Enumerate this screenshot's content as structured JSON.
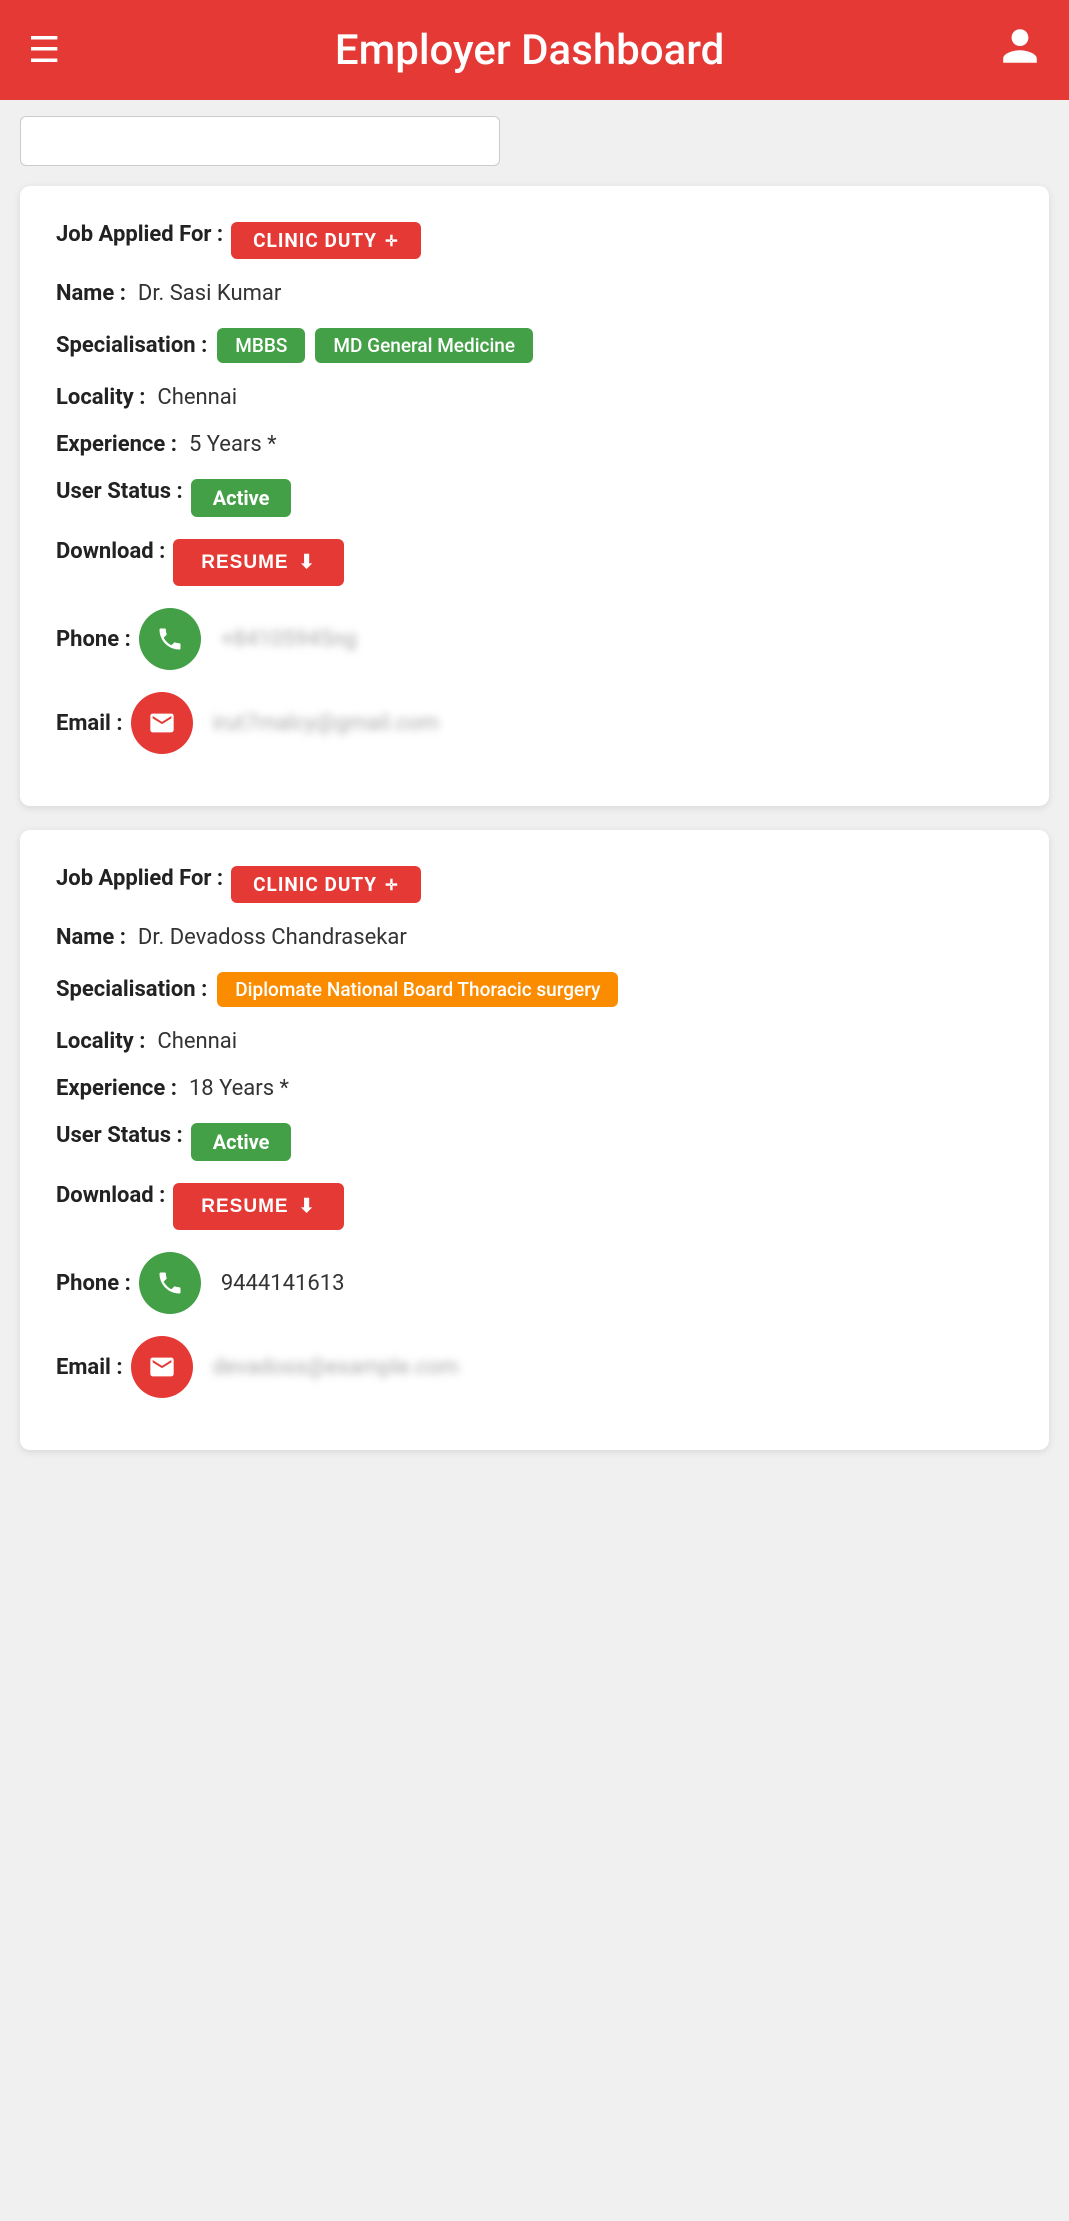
{
  "header": {
    "title": "Employer Dashboard",
    "menu_icon": "☰",
    "user_icon": "👤"
  },
  "cards": [
    {
      "id": "card-1",
      "job_applied_for_label": "Job Applied For :",
      "job_badge": "CLINIC DUTY",
      "name_label": "Name :",
      "name_value": "Dr. Sasi Kumar",
      "specialisation_label": "Specialisation :",
      "specialisations": [
        "MBBS",
        "MD General Medicine"
      ],
      "spec_colors": [
        "green",
        "green"
      ],
      "locality_label": "Locality :",
      "locality_value": "Chennai",
      "experience_label": "Experience :",
      "experience_value": "5 Years *",
      "user_status_label": "User Status :",
      "user_status_value": "Active",
      "download_label": "Download :",
      "resume_btn": "RESUME",
      "phone_label": "Phone :",
      "phone_value": "+84105945ng",
      "phone_blurred": true,
      "email_label": "Email :",
      "email_value": "irut7rnalcy@gmail.com",
      "email_blurred": true
    },
    {
      "id": "card-2",
      "job_applied_for_label": "Job Applied For :",
      "job_badge": "CLINIC DUTY",
      "name_label": "Name :",
      "name_value": "Dr. Devadoss Chandrasekar",
      "specialisation_label": "Specialisation :",
      "specialisations": [
        "Diplomate National Board Thoracic surgery"
      ],
      "spec_colors": [
        "orange"
      ],
      "locality_label": "Locality :",
      "locality_value": "Chennai",
      "experience_label": "Experience :",
      "experience_value": "18 Years *",
      "user_status_label": "User Status :",
      "user_status_value": "Active",
      "download_label": "Download :",
      "resume_btn": "RESUME",
      "phone_label": "Phone :",
      "phone_value": "9444141613",
      "phone_blurred": false,
      "email_label": "Email :",
      "email_value": "devadoss@example.com",
      "email_blurred": true
    }
  ]
}
